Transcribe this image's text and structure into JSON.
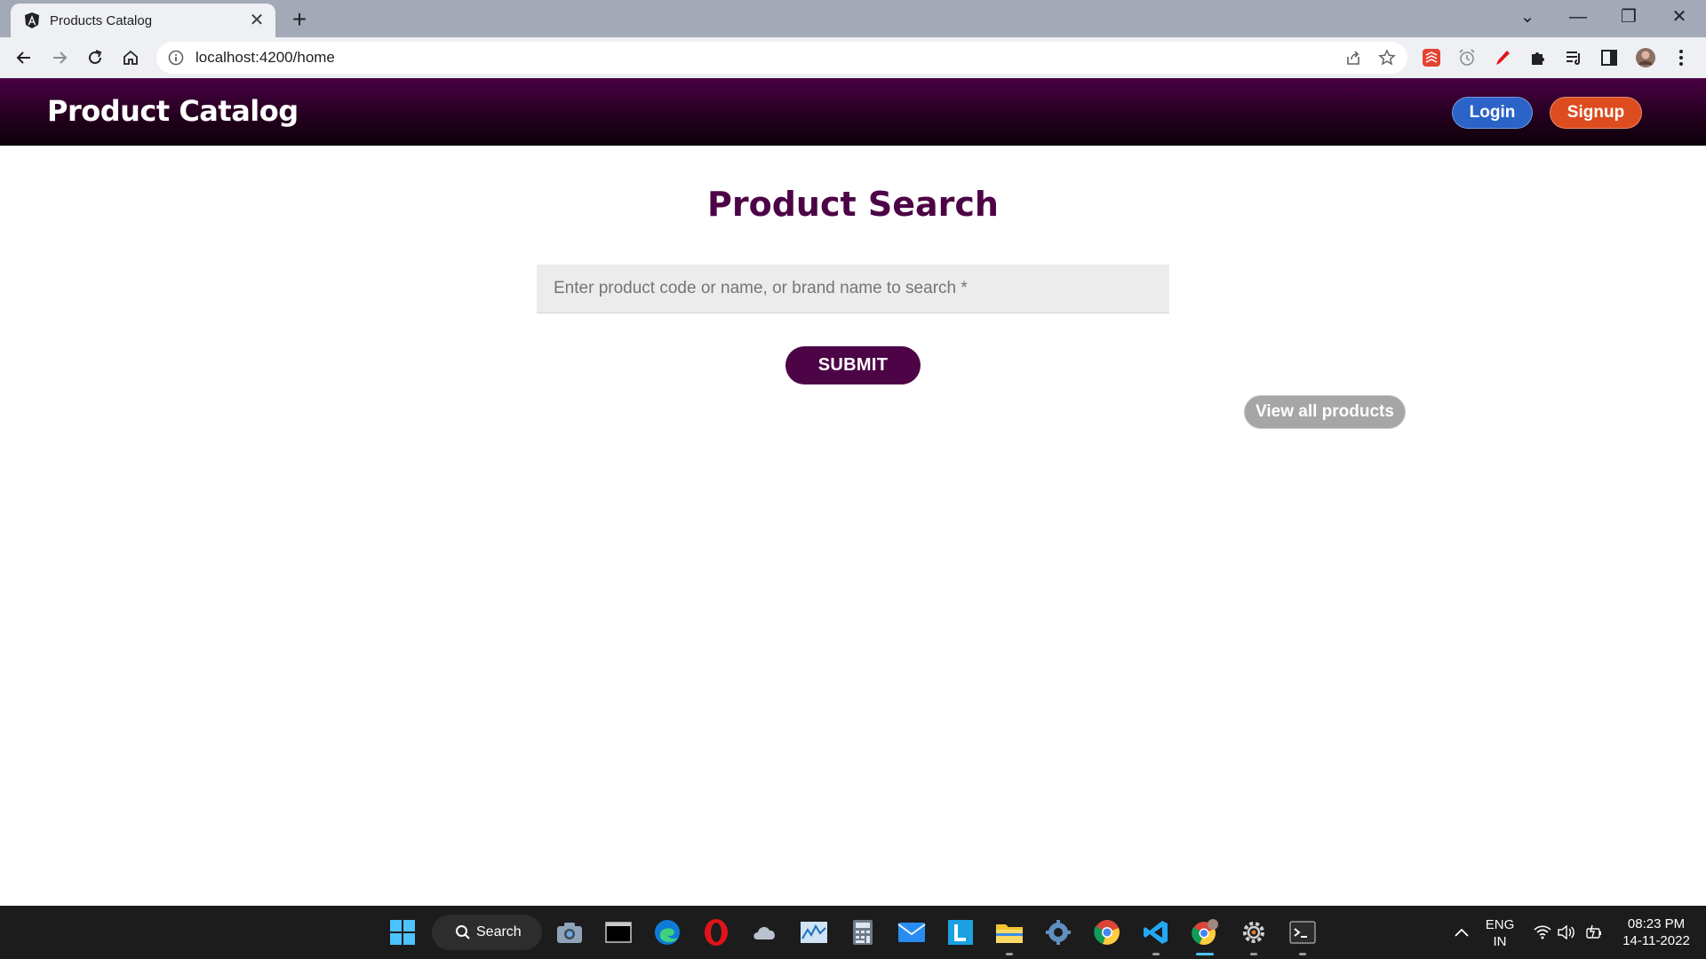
{
  "browser": {
    "tab_title": "Products Catalog",
    "tab_close": "✕",
    "new_tab": "+",
    "url": "localhost:4200/home",
    "window_controls": {
      "dropdown": "⌄",
      "minimize": "—",
      "restore": "❐",
      "close": "✕"
    }
  },
  "header": {
    "brand": "Product Catalog",
    "login_label": "Login",
    "signup_label": "Signup",
    "colors": {
      "login": "#2c63c9",
      "signup": "#dd4c1f",
      "header_top": "#4a0045"
    }
  },
  "main": {
    "heading": "Product Search",
    "search_placeholder": "Enter product code or name, or brand name to search *",
    "submit_label": "SUBMIT",
    "view_all_label": "View all products",
    "accent_color": "#4d0447"
  },
  "taskbar": {
    "search_label": "Search",
    "language_line1": "ENG",
    "language_line2": "IN",
    "time": "08:23 PM",
    "date": "14-11-2022"
  }
}
